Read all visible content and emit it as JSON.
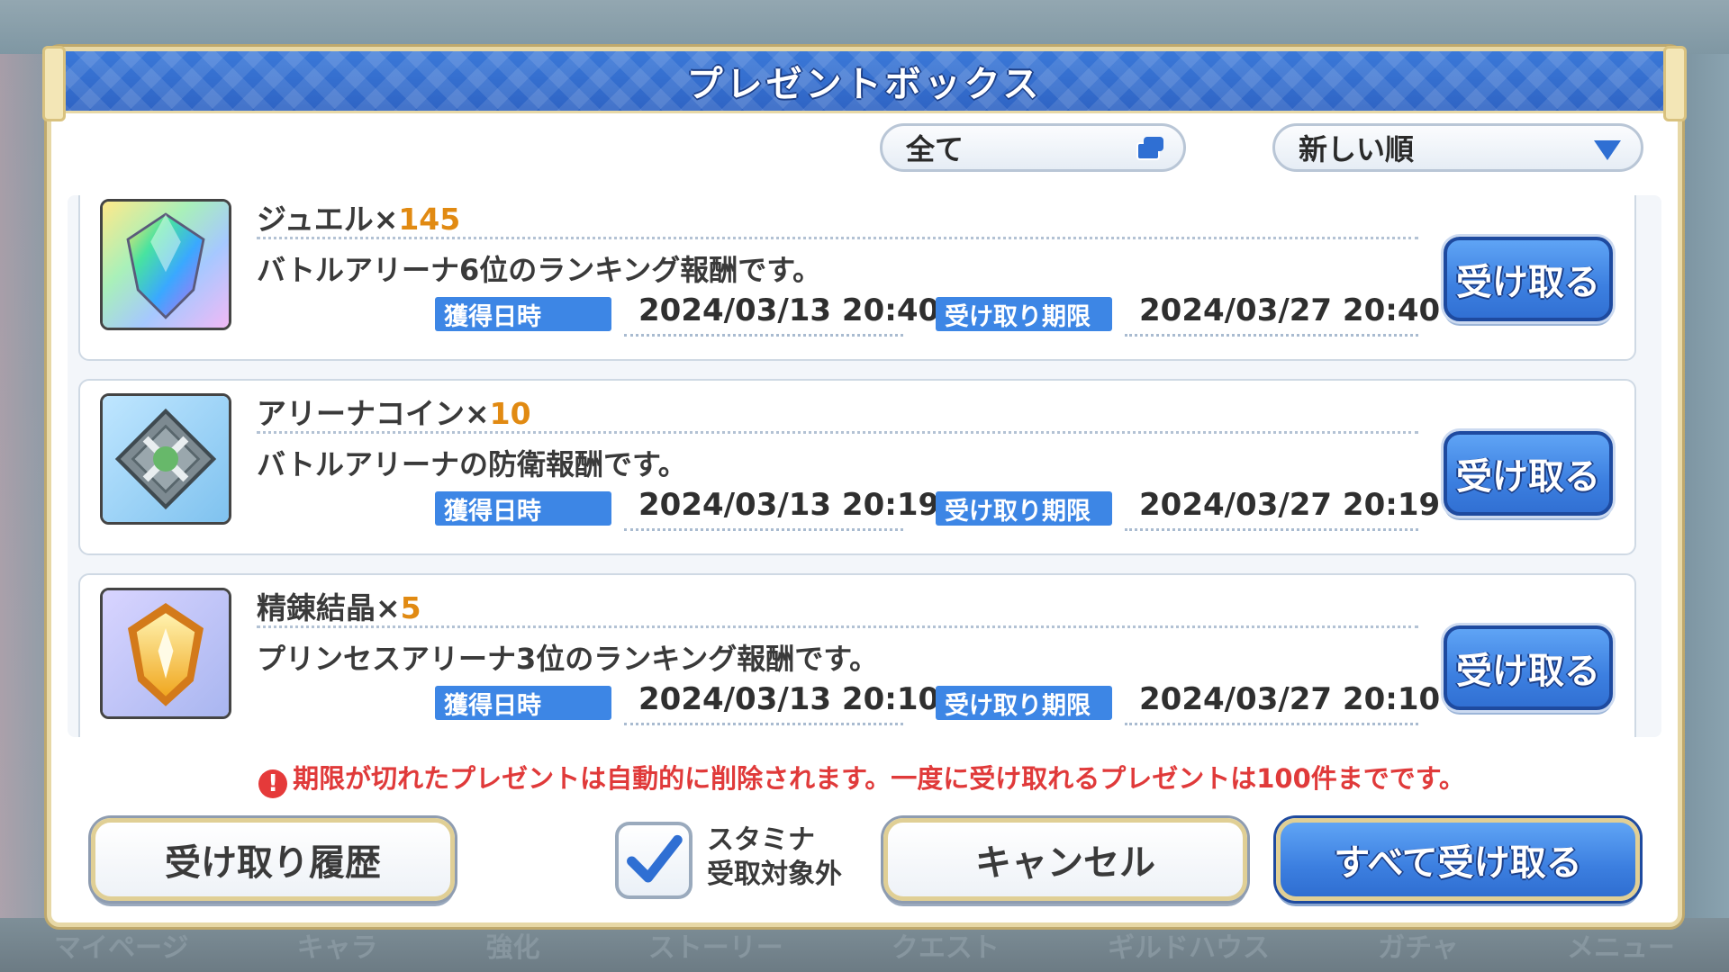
{
  "background": {
    "bottom_nav": [
      "マイページ",
      "キャラ",
      "強化",
      "ストーリー",
      "クエスト",
      "ギルドハウス",
      "ガチャ",
      "メニュー"
    ]
  },
  "dialog": {
    "title": "プレゼントボックス",
    "filter_label": "全て",
    "sort_label": "新しい順",
    "obtained_tag": "獲得日時",
    "limit_tag": "受け取り期限",
    "receive_label": "受け取る",
    "items": [
      {
        "name": "ジュエル×",
        "qty": "145",
        "desc": "バトルアリーナ6位のランキング報酬です。",
        "obtained": "2024/03/13 20:40",
        "limit": "2024/03/27 20:40",
        "icon": "jewel-icon"
      },
      {
        "name": "アリーナコイン×",
        "qty": "10",
        "desc": "バトルアリーナの防衛報酬です。",
        "obtained": "2024/03/13 20:19",
        "limit": "2024/03/27 20:19",
        "icon": "arena-coin-icon"
      },
      {
        "name": "精錬結晶×",
        "qty": "5",
        "desc": "プリンセスアリーナ3位のランキング報酬です。",
        "obtained": "2024/03/13 20:10",
        "limit": "2024/03/27 20:10",
        "icon": "refine-crystal-icon"
      }
    ],
    "notice": "期限が切れたプレゼントは自動的に削除されます。一度に受け取れるプレゼントは100件までです。",
    "history_button": "受け取り履歴",
    "stamina_line1": "スタミナ",
    "stamina_line2": "受取対象外",
    "stamina_checked": true,
    "cancel_button": "キャンセル",
    "receive_all_button": "すべて受け取る"
  },
  "colors": {
    "accent_blue": "#3d86e5",
    "qty_orange": "#e18a12",
    "warning_red": "#e03a3a",
    "gold_border": "#e0cf95"
  }
}
